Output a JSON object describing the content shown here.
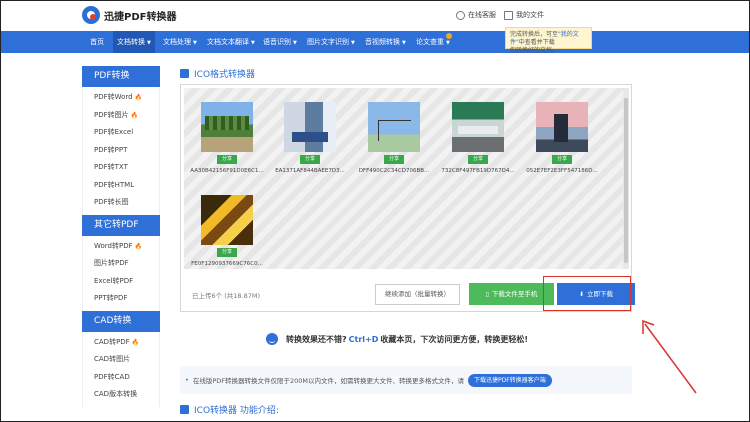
{
  "header": {
    "logo_text": "迅捷PDF转换器",
    "links": [
      "在线客服",
      "我的文件"
    ]
  },
  "nav": {
    "items": [
      {
        "label": "首页",
        "dropdown": false
      },
      {
        "label": "文档转换",
        "dropdown": true,
        "active": true
      },
      {
        "label": "文档处理",
        "dropdown": true
      },
      {
        "label": "文档文本翻译",
        "dropdown": true
      },
      {
        "label": "语音识别",
        "dropdown": true
      },
      {
        "label": "图片文字识别",
        "dropdown": true
      },
      {
        "label": "音视频转换",
        "dropdown": true
      },
      {
        "label": "论文查重",
        "dropdown": true
      }
    ]
  },
  "tooltip": {
    "line1_a": "完成转换后，可至",
    "line1_b": "\"我的文件\"",
    "line1_c": "中查看并下载",
    "line2": "你转换好的文档。"
  },
  "sidebar": {
    "sections": [
      {
        "title": "PDF转换",
        "items": [
          {
            "label": "PDF转Word",
            "hot": true
          },
          {
            "label": "PDF转图片",
            "hot": true
          },
          {
            "label": "PDF转Excel",
            "hot": false
          },
          {
            "label": "PDF转PPT",
            "hot": false
          },
          {
            "label": "PDF转TXT",
            "hot": false
          },
          {
            "label": "PDF转HTML",
            "hot": false
          },
          {
            "label": "PDF转长图",
            "hot": false
          }
        ]
      },
      {
        "title": "其它转PDF",
        "items": [
          {
            "label": "Word转PDF",
            "hot": true
          },
          {
            "label": "图片转PDF",
            "hot": false
          },
          {
            "label": "Excel转PDF",
            "hot": false
          },
          {
            "label": "PPT转PDF",
            "hot": false
          }
        ]
      },
      {
        "title": "CAD转换",
        "items": [
          {
            "label": "CAD转PDF",
            "hot": true
          },
          {
            "label": "CAD转图片",
            "hot": false
          },
          {
            "label": "PDF转CAD",
            "hot": false
          },
          {
            "label": "CAD版本转换",
            "hot": false
          }
        ]
      }
    ]
  },
  "main": {
    "title": "ICO格式转换器",
    "files": [
      {
        "name": "AA30B42156F91D0E6C1...",
        "share": "分享"
      },
      {
        "name": "EA1371AF844BAEE7D3...",
        "share": "分享"
      },
      {
        "name": "DFF490C2C34CD706BB...",
        "share": "分享"
      },
      {
        "name": "732C8F497FB19D767D4...",
        "share": "分享"
      },
      {
        "name": "052E7EF2E3FF547186D...",
        "share": "分享"
      },
      {
        "name": "FE0F1290937669C76C0...",
        "share": "分享"
      }
    ],
    "uploaded_text": "已上传6个 (共18.87M)",
    "continue_add": "继续添加（批量转换）",
    "download_to_phone": "下载文件至手机",
    "download_now": "立即下载"
  },
  "tip": {
    "before": "转换效果还不错?",
    "shortcut": "Ctrl+D",
    "after": "收藏本页，下次访问更方便，转换更轻松!"
  },
  "notice": {
    "text": "在线版PDF转换器转换文件仅限于200M以内文件，如需转换更大文件、转换更多格式文件，请",
    "button": "下载迅捷PDF转换器客户端"
  },
  "intro": {
    "title": "ICO转换器 功能介绍:"
  },
  "colors": {
    "primary": "#2e6fd8",
    "green": "#4dbb5a",
    "highlight_red": "#d9342b",
    "hot": "#f0661f"
  }
}
